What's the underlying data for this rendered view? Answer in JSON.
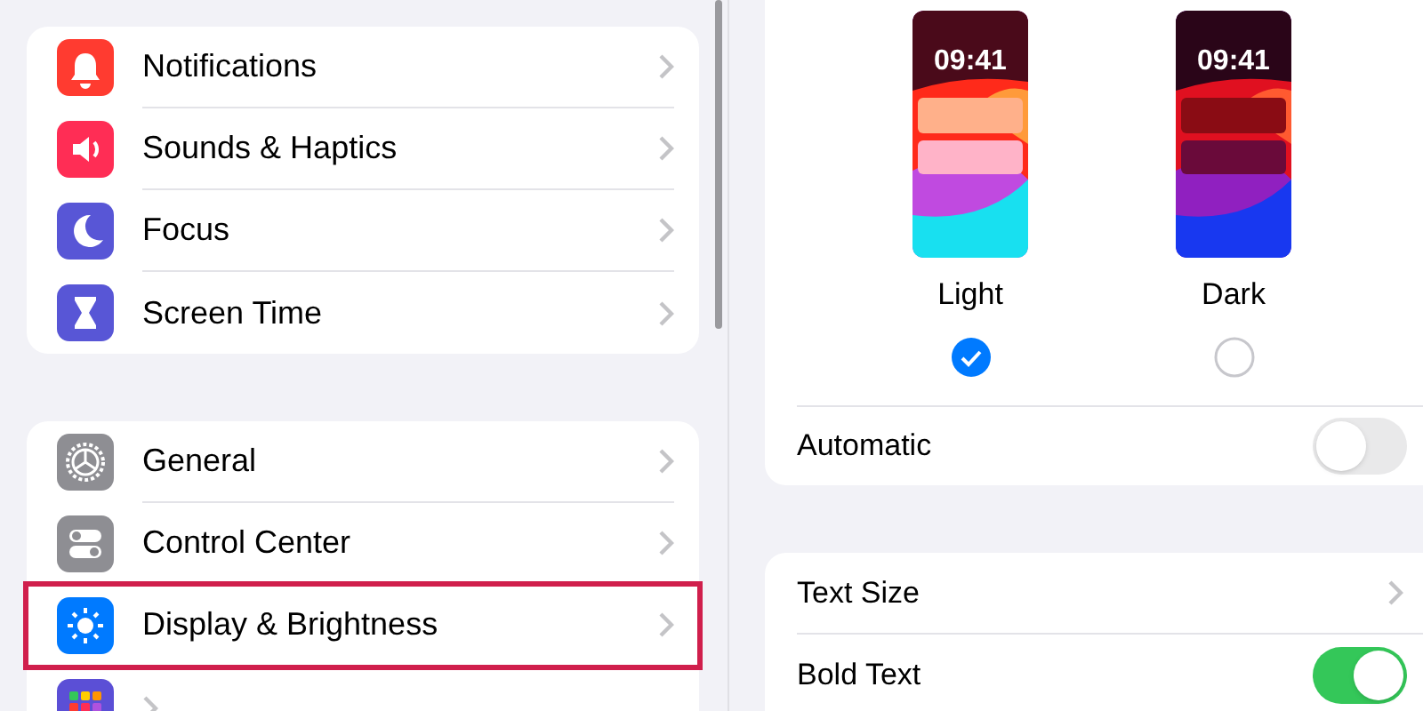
{
  "sidebar": {
    "groups": [
      {
        "items": [
          {
            "label": "Notifications",
            "color": "#ff3b30",
            "highlighted": false
          },
          {
            "label": "Sounds & Haptics",
            "color": "#ff2d55",
            "highlighted": false
          },
          {
            "label": "Focus",
            "color": "#5856d6",
            "highlighted": false
          },
          {
            "label": "Screen Time",
            "color": "#5856d6",
            "highlighted": false
          }
        ]
      },
      {
        "items": [
          {
            "label": "General",
            "color": "#8e8e93",
            "highlighted": false
          },
          {
            "label": "Control Center",
            "color": "#8e8e93",
            "highlighted": false
          },
          {
            "label": "Display & Brightness",
            "color": "#007aff",
            "highlighted": true
          },
          {
            "color": "#5b4fd6",
            "highlighted": false
          }
        ]
      }
    ]
  },
  "appearance": {
    "options": [
      {
        "label": "Light",
        "time": "09:41",
        "selected": true,
        "kind": "light"
      },
      {
        "label": "Dark",
        "time": "09:41",
        "selected": false,
        "kind": "dark"
      }
    ],
    "automatic": {
      "label": "Automatic",
      "on": false
    }
  },
  "text_settings": [
    {
      "kind": "link",
      "label": "Text Size"
    },
    {
      "kind": "toggle",
      "label": "Bold Text",
      "on": true
    }
  ]
}
